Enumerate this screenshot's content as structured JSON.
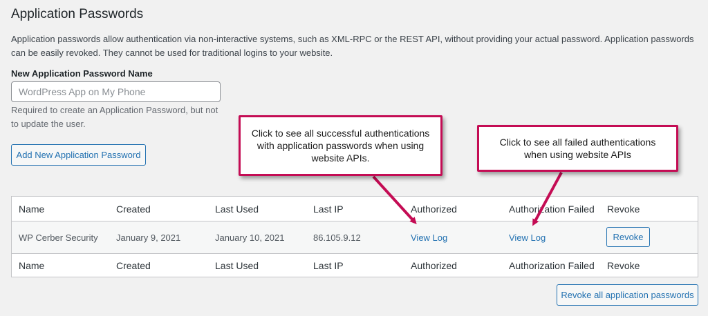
{
  "section": {
    "title": "Application Passwords",
    "description": "Application passwords allow authentication via non-interactive systems, such as XML-RPC or the REST API, without providing your actual password. Application passwords can be easily revoked. They cannot be used for traditional logins to your website."
  },
  "form": {
    "label": "New Application Password Name",
    "placeholder": "WordPress App on My Phone",
    "hint": "Required to create an Application Password, but not to update the user.",
    "add_button": "Add New Application Password"
  },
  "table": {
    "columns": [
      "Name",
      "Created",
      "Last Used",
      "Last IP",
      "Authorized",
      "Authorization Failed",
      "Revoke"
    ],
    "rows": [
      {
        "name": "WP Cerber Security",
        "created": "January 9, 2021",
        "last_used": "January 10, 2021",
        "last_ip": "86.105.9.12",
        "authorized": "View Log",
        "failed": "View Log",
        "revoke": "Revoke"
      }
    ]
  },
  "revoke_all_button": "Revoke all application passwords",
  "callouts": {
    "authorized": "Click to see all successful authentications with application passwords when using website APIs.",
    "failed": "Click to see all failed authentications when using website APIs"
  },
  "colors": {
    "accent": "#2271b1",
    "callout_border": "#c40c54"
  }
}
